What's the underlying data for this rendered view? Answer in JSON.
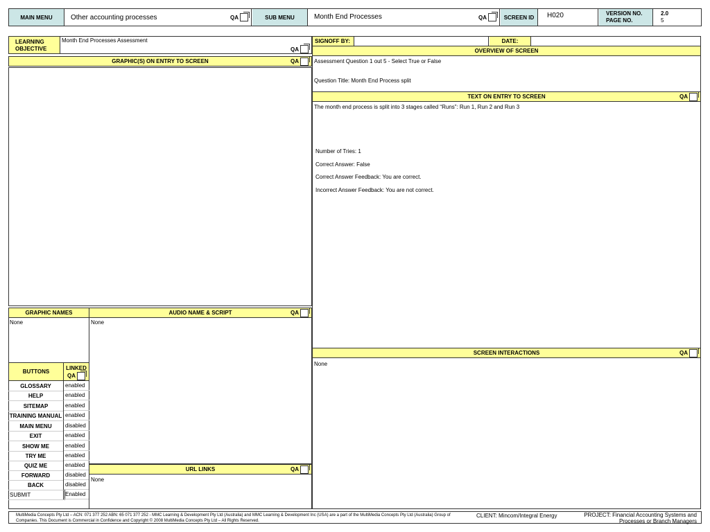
{
  "header": {
    "main_menu_label": "MAIN MENU",
    "main_menu_value": "Other accounting processes",
    "qa": "QA",
    "sub_menu_label": "SUB MENU",
    "sub_menu_value": "Month End Processes",
    "screen_id_label": "SCREEN ID",
    "screen_id_value": "H020",
    "version_label": "VERSION NO.",
    "page_label": "PAGE NO.",
    "version_value": "2.0",
    "page_value": "5"
  },
  "left": {
    "learning_objective_label": "LEARNING OBJECTIVE",
    "learning_objective_value": "Month End Processes Assessment",
    "graphics_label": "GRAPHIC(S) ON ENTRY TO SCREEN",
    "graphic_names_label": "GRAPHIC NAMES",
    "graphic_names_value": "None",
    "audio_label": "AUDIO NAME & SCRIPT",
    "audio_value": "None",
    "url_links_label": "URL LINKS",
    "url_links_value": "None",
    "buttons_label": "BUTTONS",
    "linked_label": "LINKED",
    "buttons": [
      {
        "name": "GLOSSARY",
        "status": "enabled"
      },
      {
        "name": "HELP",
        "status": "enabled"
      },
      {
        "name": "SITEMAP",
        "status": "enabled"
      },
      {
        "name": "TRAINING MANUAL",
        "status": "enabled"
      },
      {
        "name": "MAIN MENU",
        "status": "disabled"
      },
      {
        "name": "EXIT",
        "status": "enabled"
      },
      {
        "name": "SHOW ME",
        "status": "enabled"
      },
      {
        "name": "TRY ME",
        "status": "enabled"
      },
      {
        "name": "QUIZ ME",
        "status": "enabled"
      },
      {
        "name": "FORWARD",
        "status": "disabled"
      },
      {
        "name": "BACK",
        "status": "disabled"
      },
      {
        "name": "SUBMIT",
        "status": "Enabled"
      }
    ]
  },
  "right": {
    "signoff_label": "SIGNOFF BY:",
    "date_label": "DATE:",
    "overview_label": "OVERVIEW OF SCREEN",
    "overview_line1": "Assessment Question 1 out 5 - Select True or False",
    "overview_line2": "Question Title:  Month End Process split",
    "text_entry_label": "TEXT ON ENTRY TO SCREEN",
    "text_entry_line1": "The month end process is split into 3 stages called “Runs”: Run 1, Run 2 and Run 3",
    "tries": "Number of Tries: 1",
    "correct_answer": "Correct Answer:   False",
    "correct_feedback": "Correct Answer Feedback:  You are correct.",
    "incorrect_feedback": "Incorrect Answer Feedback:  You are not correct.",
    "interactions_label": "SCREEN INTERACTIONS",
    "interactions_value": "None"
  },
  "footer": {
    "copyright": "MultiMedia Concepts Pty Ltd – ACN: 071 377 252   ABN: 65 071 377 252 - MMC Learning & Development Pty Ltd (Australia) and MMC Learning & Development Inc (USA) are a part of the MultiMedia Concepts Pty Ltd (Australia) Group of Companies.    This Document is Commercial in Confidence and Copyright © 2008 MultiMedia Concepts Pty Ltd – All Rights Reserved.",
    "client": "CLIENT:  Mincom/Integral Energy",
    "project": "PROJECT: Financial Accounting Systems and Processes or Branch Managers"
  }
}
